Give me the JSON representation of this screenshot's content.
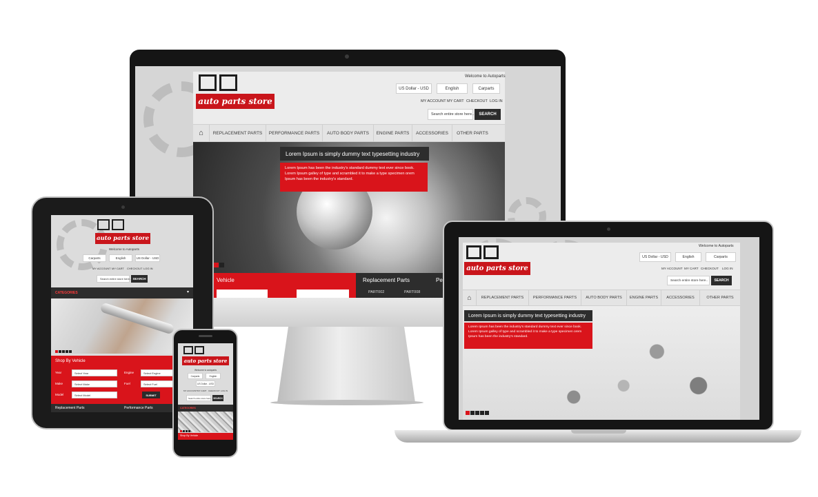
{
  "desktop": {
    "welcome": "Welcome to Autoparts",
    "logo_text": "auto parts store",
    "currency": "US Dollar - USD",
    "language": "English",
    "store": "Carparts",
    "links": [
      "MY ACCOUNT",
      "MY CART",
      "CHECKOUT",
      "LOG IN"
    ],
    "search_placeholder": "Search entire store here..",
    "search_button": "SEARCH",
    "nav": [
      "REPLACEMENT PARTS",
      "PERFORMANCE PARTS",
      "AUTO BODY PARTS",
      "ENGINE PARTS",
      "ACCESSORIES",
      "OTHER PARTS"
    ],
    "caption_title": "Lorem Ipsum is simply dummy text typesetting industry",
    "caption_body": "Lorem Ipsum has been the industry's standard dummy text ever since book. Lorem Ipsum galley of type and scrambled it to make a type specimen orem Ipsum has been the industry's standard.",
    "vehicle_label": "Vehicle",
    "replacement_title": "Replacement Parts",
    "part_links": [
      "PART002",
      "PART008"
    ],
    "trailing_fragment": "Pe"
  },
  "laptop": {
    "welcome": "Welcome to Autoparts",
    "logo_text": "auto parts store",
    "currency": "US Dollar - USD",
    "language": "English",
    "store": "Carparts",
    "links": [
      "MY ACCOUNT",
      "MY CART",
      "CHECKOUT",
      "LOG IN"
    ],
    "search_placeholder": "Search entire store here..",
    "search_button": "SEARCH",
    "nav": [
      "REPLACEMENT PARTS",
      "PERFORMANCE PARTS",
      "AUTO BODY PARTS",
      "ENGINE PARTS",
      "ACCESSORIES",
      "OTHER PARTS"
    ],
    "caption_title": "Lorem Ipsum is simply dummy text typesetting industry",
    "caption_body": "Lorem Ipsum has been the industry's standard dummy text ever since book. Lorem Ipsum galley of type and scrambled it to make a type specimen orem Ipsum has been the industry's standard."
  },
  "tablet": {
    "logo_text": "auto parts store",
    "welcome": "Welcome to Autoparts",
    "store": "Carparts",
    "language": "English",
    "currency": "US Dollar - USD",
    "links": [
      "MY ACCOUNT",
      "MY CART",
      "CHECKOUT",
      "LOG IN"
    ],
    "search_placeholder": "Search entire store here..",
    "search_button": "SEARCH",
    "categories": "CATEGORIES",
    "shop_by_vehicle": "Shop By Vehicle",
    "fields": [
      {
        "label": "Year",
        "value": "Select Year"
      },
      {
        "label": "Make",
        "value": "Select Make"
      },
      {
        "label": "Model",
        "value": "Select Model"
      },
      {
        "label": "Engine",
        "value": "Select Engine"
      },
      {
        "label": "Fuel",
        "value": "Select Fuel"
      }
    ],
    "submit": "SUBMIT",
    "footer_left": "Replacement Parts",
    "footer_right": "Performance Parts"
  },
  "phone": {
    "logo_text": "auto parts store",
    "welcome": "Welcome to autoparts",
    "store": "Carparts",
    "language": "English",
    "currency": "US Dollar - USD",
    "links": [
      "MY ACCOUNT",
      "MY CART",
      "CHECKOUT",
      "LOG IN"
    ],
    "search_placeholder": "Search entire store here..",
    "search_button": "SEARCH",
    "categories": "CATEGORIES",
    "shop_by_vehicle": "Shop By Vehicle"
  },
  "colors": {
    "brand_red": "#d9141b",
    "dark": "#2d2d2d",
    "bezel": "#1a1a1a"
  }
}
